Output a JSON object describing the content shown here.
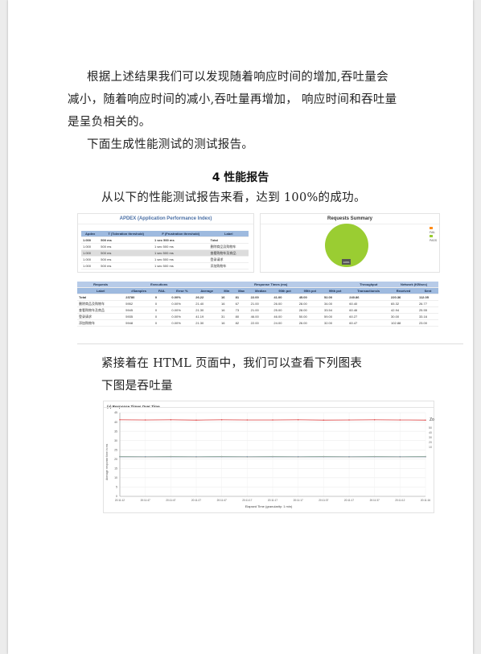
{
  "paragraphs": {
    "p1_line1": "根据上述结果我们可以发现随着响应时间的增加,吞吐量会",
    "p1_line2": "减小，随着响应时间的减小,吞吐量再增加，  响应时间和吞吐量",
    "p1_line3": "是呈负相关的。",
    "p2": "下面生成性能测试的测试报告。",
    "section_heading": "4  性能报告",
    "p3": "从以下的性能测试报告来看，达到 100%的成功。",
    "p4": "紧接着在 HTML 页面中，我们可以查看下列图表",
    "p5": "下图是吞吐量"
  },
  "apdex": {
    "title": "APDEX (Application Performance Index)",
    "columns": [
      "Apdex",
      "T (Toleration threshold)",
      "F (Frustration threshold)",
      "Label"
    ],
    "rows": [
      [
        "1.000",
        "500 ms",
        "1 sec 500 ms",
        "Total"
      ],
      [
        "1.000",
        "500 ms",
        "1 sec 500 ms",
        "删除商品及购物车"
      ],
      [
        "1.000",
        "500 ms",
        "1 sec 500 ms",
        "查看购物车及商品"
      ],
      [
        "1.000",
        "500 ms",
        "1 sec 500 ms",
        "登录请求"
      ],
      [
        "1.000",
        "500 ms",
        "1 sec 500 ms",
        "添加购物车"
      ]
    ]
  },
  "requests_summary": {
    "title": "Requests Summary",
    "legend": [
      "FAIL",
      "PASS"
    ],
    "pass_percent": 100,
    "colors": {
      "pass": "#9acd32",
      "fail": "#ff8c1a"
    }
  },
  "stats": {
    "group_headers": [
      "Requests",
      "Executions",
      "Response Times (ms)",
      "Throughput",
      "Network (KB/sec)"
    ],
    "columns": [
      "Label",
      "#Samples",
      "FAIL",
      "Error %",
      "Average",
      "Min",
      "Max",
      "Median",
      "90th pct",
      "95th pct",
      "99th pct",
      "Transactions/s",
      "Received",
      "Sent"
    ],
    "rows": [
      [
        "Total",
        "23780",
        "0",
        "0.00%",
        "26.22",
        "16",
        "81",
        "22.00",
        "41.00",
        "45.00",
        "52.00",
        "240.86",
        "220.36",
        "112.05"
      ],
      [
        "删除商品及购物车",
        "5952",
        "0",
        "0.00%",
        "21.40",
        "16",
        "67",
        "21.00",
        "26.00",
        "28.00",
        "34.00",
        "60.40",
        "65.32",
        "26.77"
      ],
      [
        "查看购物车及商品",
        "5945",
        "0",
        "0.00%",
        "21.30",
        "16",
        "73",
        "21.00",
        "25.00",
        "28.00",
        "33.54",
        "60.46",
        "42.94",
        "25.55"
      ],
      [
        "登录请求",
        "5935",
        "0",
        "0.00%",
        "41.19",
        "31",
        "80",
        "46.00",
        "46.00",
        "50.00",
        "59.00",
        "60.27",
        "30.00",
        "33.16"
      ],
      [
        "添加购物车",
        "5948",
        "0",
        "0.00%",
        "21.30",
        "16",
        "82",
        "22.00",
        "24.00",
        "26.00",
        "32.00",
        "60.47",
        "102.88",
        "23.00"
      ]
    ]
  },
  "response_chart": {
    "title": "(a) Response Times Over Time",
    "ylabel": "Average response time in ms",
    "xlabel": "Elapsed Time (granularity: 1 min)",
    "y_ticks": [
      "0",
      "5",
      "10",
      "15",
      "20",
      "25",
      "30",
      "35",
      "40",
      "45"
    ],
    "x_ticks": [
      "20:11:12",
      "20:11:47",
      "20:11:47",
      "20:11:27",
      "20:11:47",
      "20:11:17",
      "20:11:17",
      "20:11:17",
      "20:11:37",
      "20:11:17",
      "20:11:37",
      "20:11:12",
      "20:11:16"
    ],
    "legend_head": "Zo",
    "legend_ticks": [
      "50",
      "40",
      "30",
      "20",
      "10"
    ],
    "chart_data": {
      "type": "line",
      "ylim": [
        0,
        45
      ],
      "series": [
        {
          "color": "#e05555",
          "values": [
            41.2,
            41.1,
            41.2,
            41.0,
            41.2,
            41.1,
            41.1,
            41.2,
            41.0,
            41.1,
            41.2,
            41.1,
            41.0
          ]
        },
        {
          "color": "#5cb85c",
          "values": [
            21.4,
            21.3,
            21.4,
            21.3,
            21.4,
            21.3,
            21.4,
            21.3,
            21.4,
            21.3,
            21.4,
            21.3,
            21.4
          ]
        },
        {
          "color": "#4a78c8",
          "values": [
            21.3,
            21.3,
            21.3,
            21.3,
            21.3,
            21.3,
            21.3,
            21.3,
            21.3,
            21.3,
            21.3,
            21.3,
            21.3
          ]
        },
        {
          "color": "#aaaaaa",
          "values": [
            21.3,
            21.2,
            21.3,
            21.2,
            21.3,
            21.2,
            21.3,
            21.2,
            21.3,
            21.2,
            21.3,
            21.2,
            21.3
          ]
        }
      ]
    }
  }
}
